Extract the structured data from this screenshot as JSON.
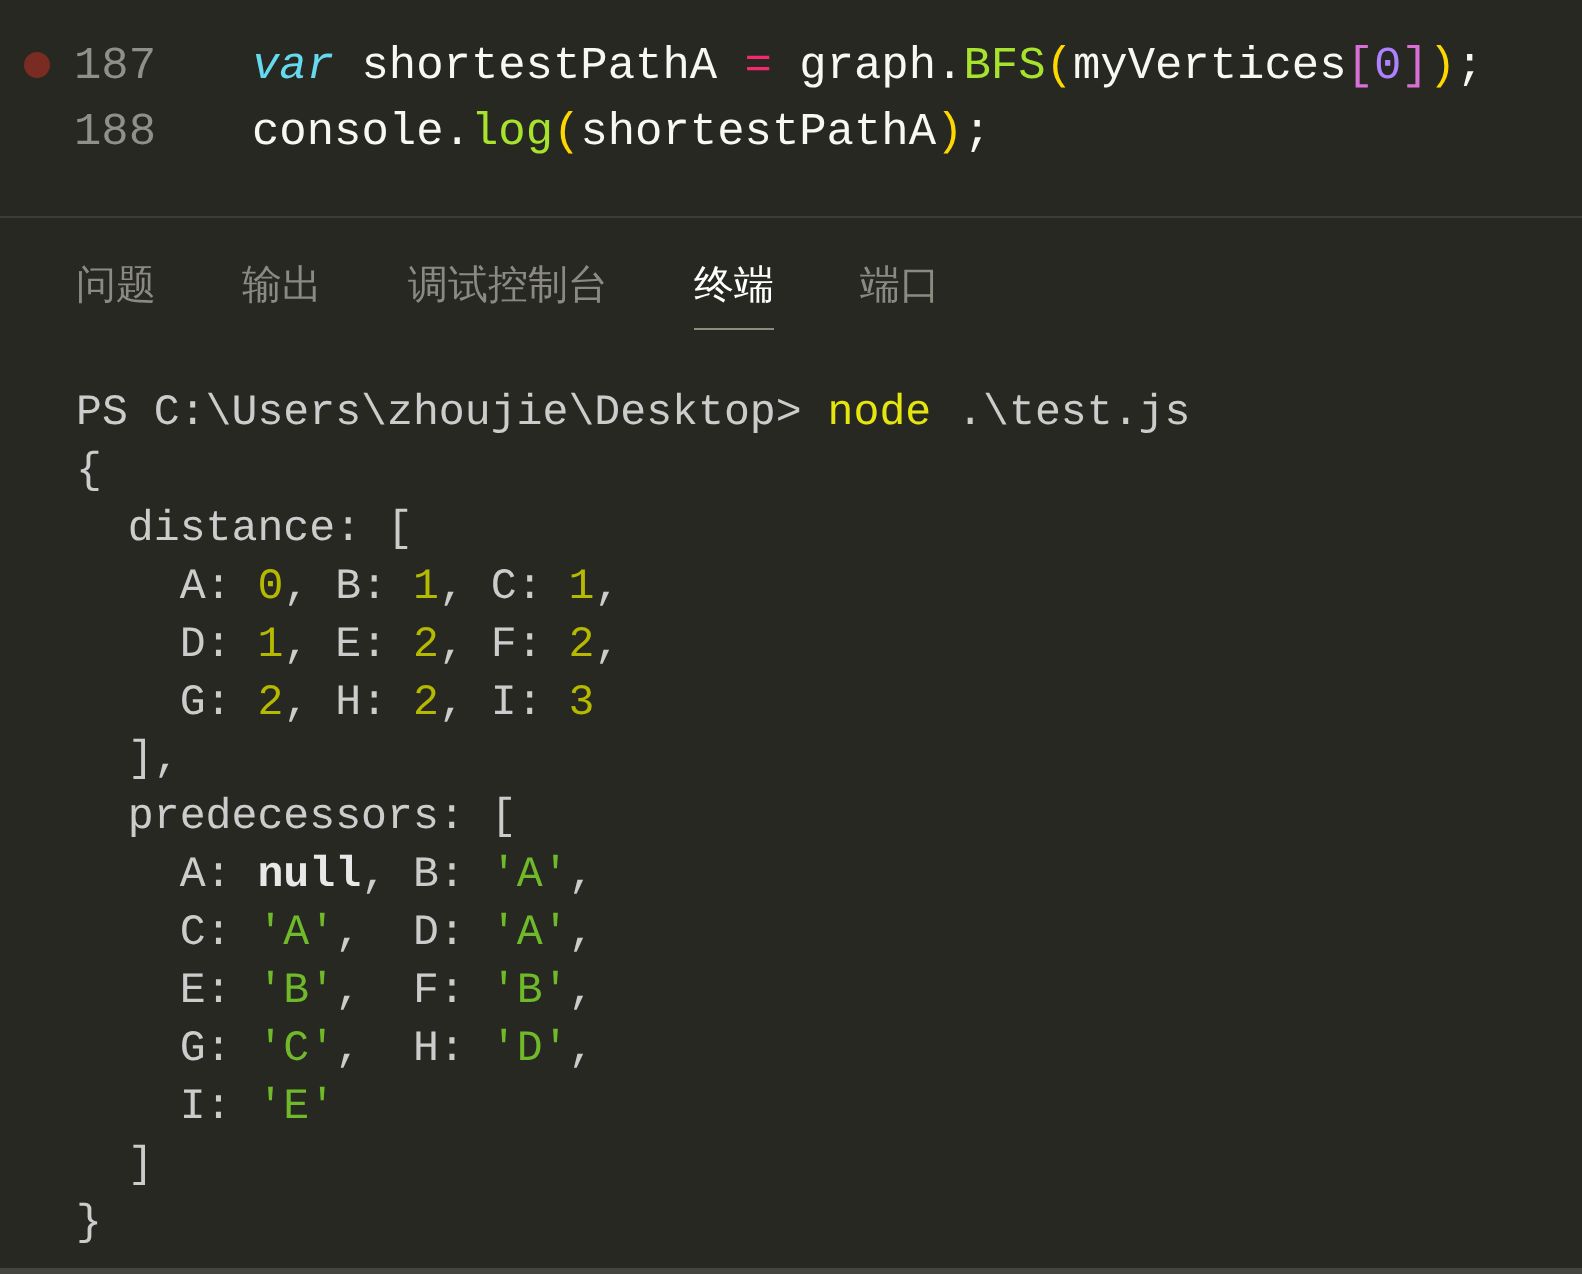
{
  "editor": {
    "lines": [
      {
        "number": "187",
        "breakpoint": true,
        "tokens": [
          {
            "text": "var",
            "kind": "keyword"
          },
          {
            "text": " shortestPathA ",
            "kind": "plain"
          },
          {
            "text": "=",
            "kind": "operator"
          },
          {
            "text": " graph.",
            "kind": "plain"
          },
          {
            "text": "BFS",
            "kind": "function"
          },
          {
            "text": "(",
            "kind": "paren"
          },
          {
            "text": "myVertices",
            "kind": "plain"
          },
          {
            "text": "[",
            "kind": "bracket"
          },
          {
            "text": "0",
            "kind": "number"
          },
          {
            "text": "]",
            "kind": "bracket"
          },
          {
            "text": ")",
            "kind": "paren"
          },
          {
            "text": ";",
            "kind": "plain"
          }
        ]
      },
      {
        "number": "188",
        "breakpoint": false,
        "tokens": [
          {
            "text": "console.",
            "kind": "plain"
          },
          {
            "text": "log",
            "kind": "function"
          },
          {
            "text": "(",
            "kind": "paren"
          },
          {
            "text": "shortestPathA",
            "kind": "plain"
          },
          {
            "text": ")",
            "kind": "paren"
          },
          {
            "text": ";",
            "kind": "plain"
          }
        ]
      }
    ]
  },
  "panel": {
    "tabs": [
      {
        "label": "问题",
        "selected": false
      },
      {
        "label": "输出",
        "selected": false
      },
      {
        "label": "调试控制台",
        "selected": false
      },
      {
        "label": "终端",
        "selected": true
      },
      {
        "label": "端口",
        "selected": false
      }
    ]
  },
  "terminal": {
    "lines": [
      [
        {
          "text": "PS C:\\Users\\zhoujie\\Desktop> ",
          "kind": "plain"
        },
        {
          "text": "node",
          "kind": "command"
        },
        {
          "text": " .\\test.js",
          "kind": "plain"
        }
      ],
      [
        {
          "text": "{",
          "kind": "plain"
        }
      ],
      [
        {
          "text": "  distance: [",
          "kind": "plain"
        }
      ],
      [
        {
          "text": "    A: ",
          "kind": "plain"
        },
        {
          "text": "0",
          "kind": "number"
        },
        {
          "text": ", B: ",
          "kind": "plain"
        },
        {
          "text": "1",
          "kind": "number"
        },
        {
          "text": ", C: ",
          "kind": "plain"
        },
        {
          "text": "1",
          "kind": "number"
        },
        {
          "text": ",",
          "kind": "plain"
        }
      ],
      [
        {
          "text": "    D: ",
          "kind": "plain"
        },
        {
          "text": "1",
          "kind": "number"
        },
        {
          "text": ", E: ",
          "kind": "plain"
        },
        {
          "text": "2",
          "kind": "number"
        },
        {
          "text": ", F: ",
          "kind": "plain"
        },
        {
          "text": "2",
          "kind": "number"
        },
        {
          "text": ",",
          "kind": "plain"
        }
      ],
      [
        {
          "text": "    G: ",
          "kind": "plain"
        },
        {
          "text": "2",
          "kind": "number"
        },
        {
          "text": ", H: ",
          "kind": "plain"
        },
        {
          "text": "2",
          "kind": "number"
        },
        {
          "text": ", I: ",
          "kind": "plain"
        },
        {
          "text": "3",
          "kind": "number"
        }
      ],
      [
        {
          "text": "  ],",
          "kind": "plain"
        }
      ],
      [
        {
          "text": "  predecessors: [",
          "kind": "plain"
        }
      ],
      [
        {
          "text": "    A: ",
          "kind": "plain"
        },
        {
          "text": "null",
          "kind": "null"
        },
        {
          "text": ", B: ",
          "kind": "plain"
        },
        {
          "text": "'A'",
          "kind": "string"
        },
        {
          "text": ",",
          "kind": "plain"
        }
      ],
      [
        {
          "text": "    C: ",
          "kind": "plain"
        },
        {
          "text": "'A'",
          "kind": "string"
        },
        {
          "text": ",  D: ",
          "kind": "plain"
        },
        {
          "text": "'A'",
          "kind": "string"
        },
        {
          "text": ",",
          "kind": "plain"
        }
      ],
      [
        {
          "text": "    E: ",
          "kind": "plain"
        },
        {
          "text": "'B'",
          "kind": "string"
        },
        {
          "text": ",  F: ",
          "kind": "plain"
        },
        {
          "text": "'B'",
          "kind": "string"
        },
        {
          "text": ",",
          "kind": "plain"
        }
      ],
      [
        {
          "text": "    G: ",
          "kind": "plain"
        },
        {
          "text": "'C'",
          "kind": "string"
        },
        {
          "text": ",  H: ",
          "kind": "plain"
        },
        {
          "text": "'D'",
          "kind": "string"
        },
        {
          "text": ",",
          "kind": "plain"
        }
      ],
      [
        {
          "text": "    I: ",
          "kind": "plain"
        },
        {
          "text": "'E'",
          "kind": "string"
        }
      ],
      [
        {
          "text": "  ]",
          "kind": "plain"
        }
      ],
      [
        {
          "text": "}",
          "kind": "plain"
        }
      ]
    ]
  }
}
